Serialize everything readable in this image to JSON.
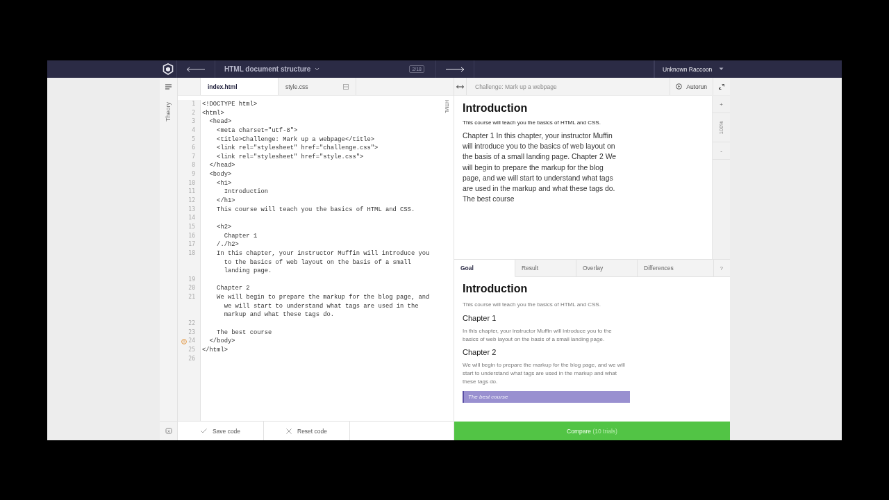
{
  "header": {
    "title": "HTML document structure",
    "counter": "2/18",
    "user": "Unknown Raccoon"
  },
  "sidebar": {
    "label": "Theory"
  },
  "editor": {
    "tabs": [
      {
        "label": "index.html",
        "selected": true
      },
      {
        "label": "style.css",
        "selected": false
      }
    ],
    "side_label": "HTML",
    "lines": [
      {
        "num": "1",
        "parts": [
          "<!DOCTYPE html>"
        ],
        "warning": false
      },
      {
        "num": "2",
        "parts": [
          "<html>"
        ],
        "warning": false
      },
      {
        "num": "3",
        "parts": [
          "  <head>"
        ],
        "warning": false
      },
      {
        "num": "4",
        "parts": [
          "    <meta charset=\"utf-8\">"
        ],
        "warning": false
      },
      {
        "num": "5",
        "parts": [
          "    <title>Challenge: Mark up a webpage</title>"
        ],
        "warning": false
      },
      {
        "num": "6",
        "parts": [
          "    <link rel=\"stylesheet\" href=\"challenge.css\">"
        ],
        "warning": false
      },
      {
        "num": "7",
        "parts": [
          "    <link rel=\"stylesheet\" href=\"style.css\">"
        ],
        "warning": false
      },
      {
        "num": "8",
        "parts": [
          "  </head>"
        ],
        "warning": false
      },
      {
        "num": "9",
        "parts": [
          "  <body>"
        ],
        "warning": false
      },
      {
        "num": "10",
        "parts": [
          "    <h1>"
        ],
        "warning": false
      },
      {
        "num": "11",
        "parts": [
          "      Introduction"
        ],
        "warning": false
      },
      {
        "num": "12",
        "parts": [
          "    </h1>"
        ],
        "warning": false
      },
      {
        "num": "13",
        "parts": [
          "    This course will teach you the basics of HTML and CSS."
        ],
        "warning": false
      },
      {
        "num": "14",
        "warning": false
      },
      {
        "num": "15",
        "parts": [
          "    <h2>"
        ],
        "warning": false
      },
      {
        "num": "16",
        "parts": [
          "      Chapter 1"
        ],
        "warning": false
      },
      {
        "num": "17",
        "parts": [
          "    /./h2>"
        ],
        "warning": false
      },
      {
        "num": "18",
        "parts": [
          "    In this chapter, your instructor Muffin will introduce you",
          "      to the basics of web layout on the basis of a small",
          "      landing page."
        ],
        "warning": false
      },
      {
        "num": "19",
        "warning": false
      },
      {
        "num": "20",
        "parts": [
          "    Chapter 2"
        ],
        "warning": false
      },
      {
        "num": "21",
        "parts": [
          "    We will begin to prepare the markup for the blog page, and",
          "      we will start to understand what tags are used in the",
          "      markup and what these tags do."
        ],
        "warning": false
      },
      {
        "num": "22",
        "warning": false
      },
      {
        "num": "23",
        "parts": [
          "    The best course"
        ],
        "warning": false
      },
      {
        "num": "24",
        "parts": [
          "  </body>"
        ],
        "warning": true
      },
      {
        "num": "25",
        "parts": [
          "</html>"
        ],
        "warning": false
      },
      {
        "num": "26",
        "warning": false
      }
    ],
    "save": "Save code",
    "reset": "Reset code"
  },
  "preview": {
    "title": "Challenge: Mark up a webpage",
    "autorun": "Autorun",
    "blocks": [
      {
        "kind": "h1",
        "text": "Introduction"
      },
      {
        "kind": "small",
        "text": "This course will teach you the basics of HTML and CSS."
      },
      {
        "kind": "p",
        "text": "Chapter 1 In this chapter, your instructor Muffin will introduce you to the basics of web layout on the basis of a small landing page. Chapter 2 We will begin to prepare the markup for the blog page, and we will start to understand what tags are used in the markup and what these tags do. The best course"
      }
    ],
    "zoom": {
      "plus": "+",
      "level": "100%",
      "minus": "-"
    }
  },
  "goal": {
    "tabs": [
      {
        "label": "Goal",
        "selected": true
      },
      {
        "label": "Result",
        "selected": false
      },
      {
        "label": "Overlay",
        "selected": false
      },
      {
        "label": "Differences",
        "selected": false
      }
    ],
    "help": "?",
    "blocks": [
      {
        "kind": "h1",
        "text": "Introduction"
      },
      {
        "kind": "muted",
        "text": "This course will teach you the basics of HTML and CSS."
      },
      {
        "kind": "h2",
        "text": "Chapter 1"
      },
      {
        "kind": "muted",
        "text": "In this chapter, your instructor Muffin will introduce you to the basics of web layout on the basis of a small landing page."
      },
      {
        "kind": "h2",
        "text": "Chapter 2"
      },
      {
        "kind": "muted",
        "text": "We will begin to prepare the markup for the blog page, and we will start to understand what tags are used in the markup and what these tags do."
      },
      {
        "kind": "quote",
        "text": "The best course"
      }
    ],
    "compare": "Compare",
    "trials": "(10 trials)"
  }
}
